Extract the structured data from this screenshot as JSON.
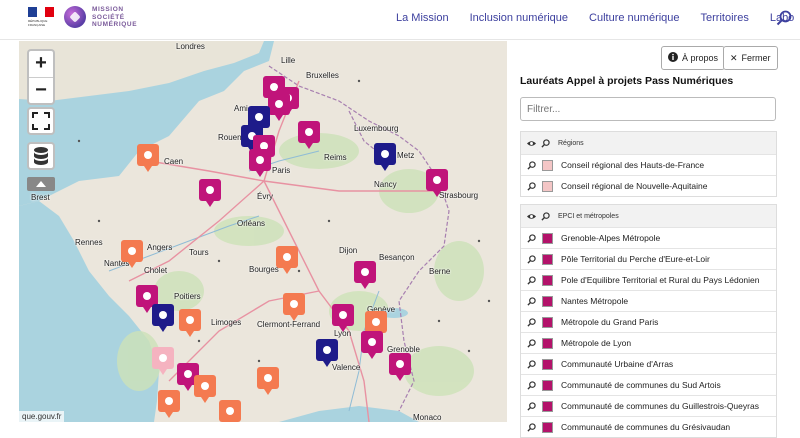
{
  "header": {
    "nav": [
      "La Mission",
      "Inclusion numérique",
      "Culture numérique",
      "Territoires",
      "Labo"
    ],
    "logo_text": [
      "MISSION",
      "SOCIÉTÉ",
      "NUMÉRIQUE"
    ],
    "rf_text": "RÉPUBLIQUE FRANÇAISE"
  },
  "map": {
    "attribution": "que.gouv.fr",
    "cities": [
      "Londres",
      "Bruxelles",
      "Luxembourg",
      "Caen",
      "Rouen",
      "Reims",
      "Paris",
      "Évry",
      "Nancy",
      "Strasbourg",
      "Rennes",
      "Orléans",
      "Tours",
      "Angers",
      "Nantes",
      "Cholet",
      "Dijon",
      "Bourges",
      "Besançon",
      "Berne",
      "Poitiers",
      "Limoges",
      "Clermont-Ferrand",
      "Lyon",
      "Grenoble",
      "Valence",
      "Monaco",
      "Brest",
      "Amiens",
      "Lille",
      "Metz",
      "Genève"
    ]
  },
  "panel": {
    "about_label": "À propos",
    "close_label": "Fermer",
    "title": "Lauréats Appel à projets Pass Numériques",
    "filter_placeholder": "Filtrer...",
    "groups": [
      {
        "label": "Régions",
        "items": [
          {
            "label": "Conseil régional des Hauts-de-France",
            "color": "#f4c6c6"
          },
          {
            "label": "Conseil régional de Nouvelle-Aquitaine",
            "color": "#f4c6c6"
          }
        ]
      },
      {
        "label": "EPCI et métropoles",
        "items": [
          {
            "label": "Grenoble-Alpes Métropole",
            "color": "#b3126a"
          },
          {
            "label": "Pôle Territorial du Perche d'Eure-et-Loir",
            "color": "#b3126a"
          },
          {
            "label": "Pole d'Equilibre Territorial et Rural du Pays Lédonien",
            "color": "#b3126a"
          },
          {
            "label": "Nantes Métropole",
            "color": "#b3126a"
          },
          {
            "label": "Métropole du Grand Paris",
            "color": "#b3126a"
          },
          {
            "label": "Métropole de Lyon",
            "color": "#b3126a"
          },
          {
            "label": "Communauté Urbaine d'Arras",
            "color": "#b3126a"
          },
          {
            "label": "Communauté de communes du Sud Artois",
            "color": "#b3126a"
          },
          {
            "label": "Communauté de communes du Guillestrois-Queyras",
            "color": "#b3126a"
          },
          {
            "label": "Communauté de communes du Grésivaudan",
            "color": "#b3126a"
          }
        ]
      }
    ]
  },
  "colors": {
    "nav": "#3c3f9e",
    "marker_magenta": "#c0147a",
    "marker_orange": "#f47a50",
    "marker_navy": "#1e1b8a",
    "marker_pink": "#f5b3c0"
  }
}
